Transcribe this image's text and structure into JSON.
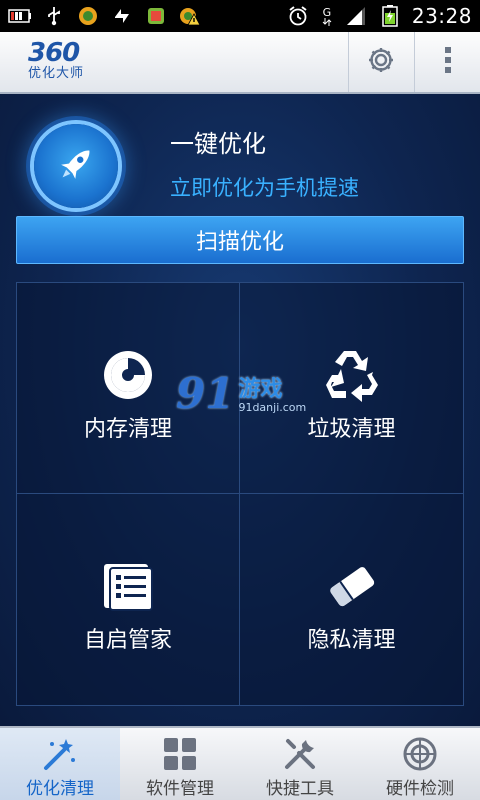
{
  "status_bar": {
    "time": "23:28",
    "network_label": "G",
    "icons": [
      "battery-icon",
      "usb-icon",
      "app-icon",
      "sync-icon",
      "app-icon",
      "warning-icon",
      "alarm-icon",
      "signal-icon",
      "battery-charging-icon"
    ]
  },
  "header": {
    "logo_number": "360",
    "logo_subtitle": "优化大师",
    "settings_icon": "gear-icon",
    "menu_icon": "overflow-menu-icon"
  },
  "optimize": {
    "title": "一键优化",
    "subtitle": "立即优化为手机提速",
    "scan_button": "扫描优化"
  },
  "grid": {
    "items": [
      {
        "label": "内存清理",
        "icon": "memory-clean-icon"
      },
      {
        "label": "垃圾清理",
        "icon": "recycle-icon"
      },
      {
        "label": "自启管家",
        "icon": "startup-manager-icon"
      },
      {
        "label": "隐私清理",
        "icon": "eraser-icon"
      }
    ]
  },
  "watermark": {
    "number": "91",
    "text": "游戏",
    "url": "91danji.com"
  },
  "tabs": [
    {
      "label": "优化清理",
      "icon": "magic-wand-icon",
      "active": true
    },
    {
      "label": "软件管理",
      "icon": "apps-grid-icon",
      "active": false
    },
    {
      "label": "快捷工具",
      "icon": "tools-icon",
      "active": false
    },
    {
      "label": "硬件检测",
      "icon": "target-icon",
      "active": false
    }
  ],
  "colors": {
    "accent": "#1a6ed0",
    "subtitle": "#39b1ff",
    "background": "#0e2550"
  }
}
